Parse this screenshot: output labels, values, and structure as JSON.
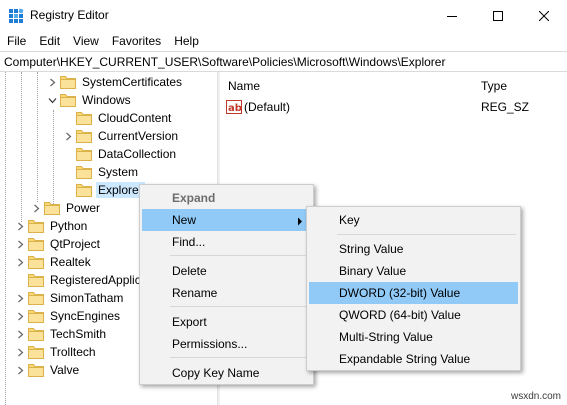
{
  "window": {
    "title": "Registry Editor",
    "icon": "registry-editor-icon",
    "controls": [
      "minimize-icon",
      "maximize-icon",
      "close-icon"
    ]
  },
  "menubar": [
    "File",
    "Edit",
    "View",
    "Favorites",
    "Help"
  ],
  "address": "Computer\\HKEY_CURRENT_USER\\Software\\Policies\\Microsoft\\Windows\\Explorer",
  "tree": {
    "items": [
      {
        "label": "SystemCertificates",
        "expander": "chevron-right-icon"
      },
      {
        "label": "Windows",
        "expander": "chevron-down-icon"
      },
      {
        "label": "CloudContent",
        "expander": ""
      },
      {
        "label": "CurrentVersion",
        "expander": "chevron-right-icon"
      },
      {
        "label": "DataCollection",
        "expander": ""
      },
      {
        "label": "System",
        "expander": ""
      },
      {
        "label": "Explorer",
        "expander": "",
        "selected": true
      },
      {
        "label": "Power",
        "expander": "chevron-right-icon"
      },
      {
        "label": "Python",
        "expander": "chevron-right-icon"
      },
      {
        "label": "QtProject",
        "expander": "chevron-right-icon"
      },
      {
        "label": "Realtek",
        "expander": "chevron-right-icon"
      },
      {
        "label": "RegisteredApplic",
        "expander": ""
      },
      {
        "label": "SimonTatham",
        "expander": "chevron-right-icon"
      },
      {
        "label": "SyncEngines",
        "expander": "chevron-right-icon"
      },
      {
        "label": "TechSmith",
        "expander": "chevron-right-icon"
      },
      {
        "label": "Trolltech",
        "expander": "chevron-right-icon"
      },
      {
        "label": "Valve",
        "expander": "chevron-right-icon"
      }
    ]
  },
  "values": {
    "headers": {
      "name": "Name",
      "type": "Type"
    },
    "rows": [
      {
        "name": "(Default)",
        "type": "REG_SZ",
        "icon": "string-value-icon"
      }
    ]
  },
  "context_menu": {
    "items": [
      {
        "label": "Expand",
        "disabled": true
      },
      {
        "label": "New",
        "highlight": true,
        "submenu": true
      },
      {
        "label": "Find..."
      },
      {
        "label": "Delete"
      },
      {
        "label": "Rename"
      },
      {
        "label": "Export"
      },
      {
        "label": "Permissions..."
      },
      {
        "label": "Copy Key Name"
      }
    ]
  },
  "submenu": {
    "items": [
      {
        "label": "Key"
      },
      {
        "label": "String Value"
      },
      {
        "label": "Binary Value"
      },
      {
        "label": "DWORD (32-bit) Value",
        "highlight": true
      },
      {
        "label": "QWORD (64-bit) Value"
      },
      {
        "label": "Multi-String Value"
      },
      {
        "label": "Expandable String Value"
      }
    ]
  },
  "watermark": "wsxdn.com",
  "colors": {
    "selection": "#cce8ff",
    "menu_highlight": "#91c9f7",
    "folder": "#f8d775",
    "menu_bg": "#f2f2f2"
  }
}
